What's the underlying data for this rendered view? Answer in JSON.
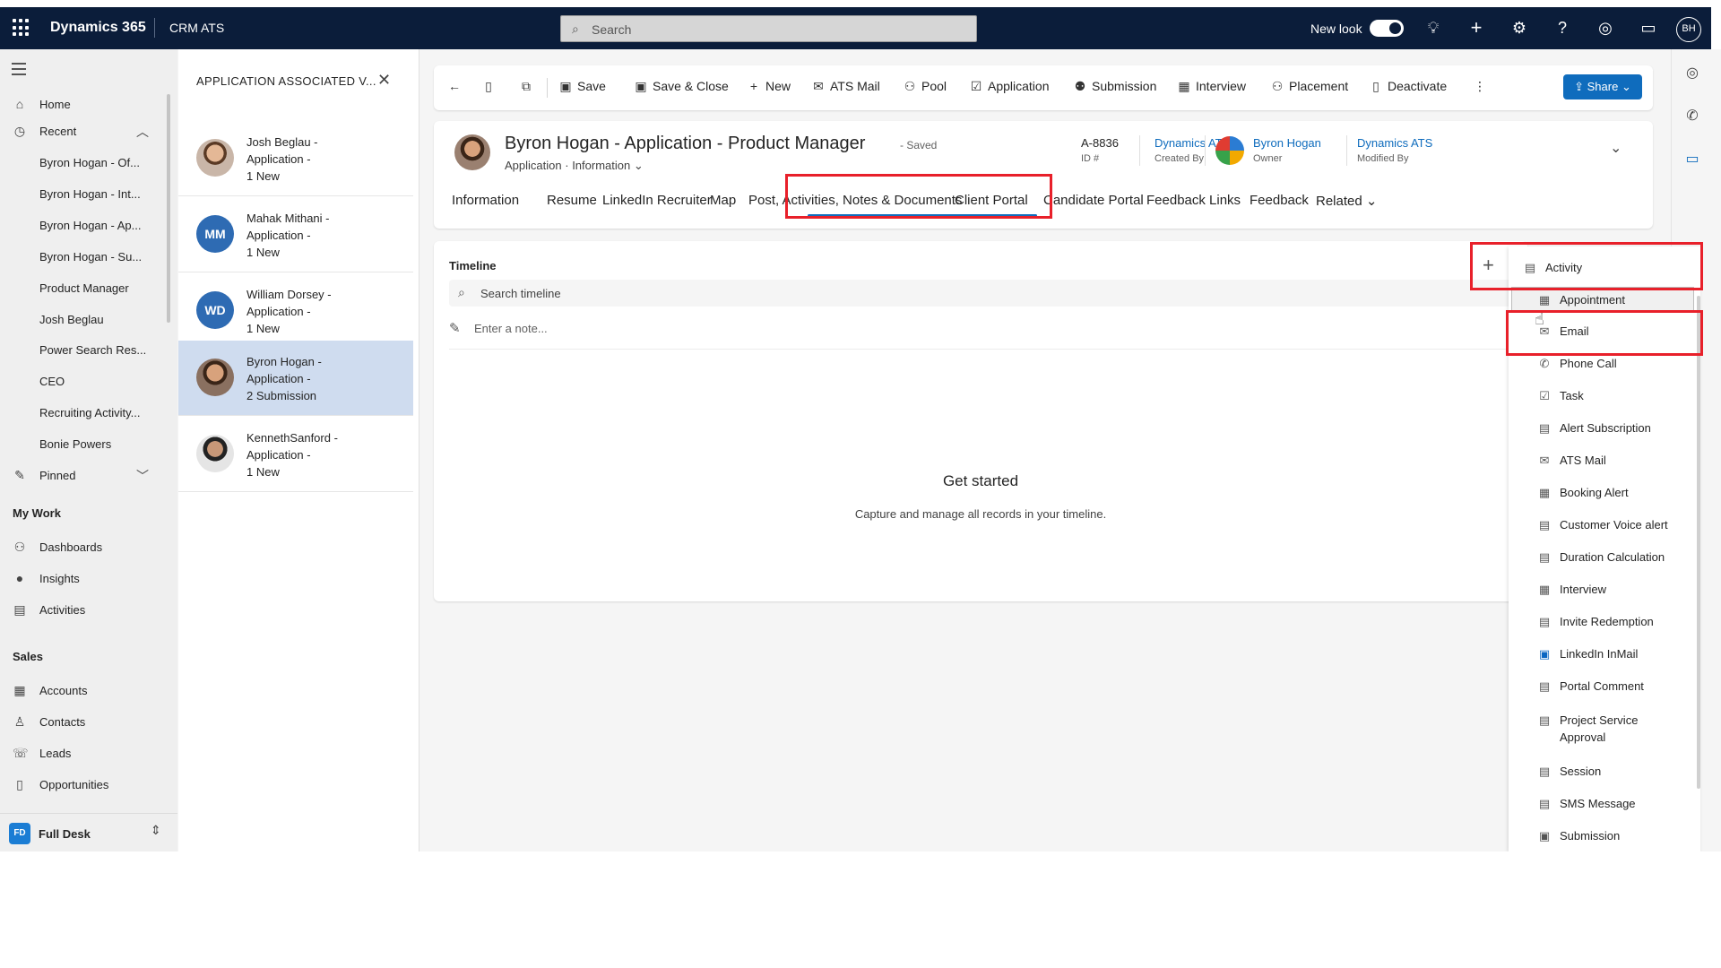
{
  "topbar": {
    "brand": "Dynamics 365",
    "app_name": "CRM ATS",
    "search_placeholder": "Search",
    "new_look_label": "New look",
    "avatar_initials": "BH"
  },
  "sidebar": {
    "home": "Home",
    "recent": "Recent",
    "recent_items": [
      "Byron Hogan - Of...",
      "Byron Hogan - Int...",
      "Byron Hogan - Ap...",
      "Byron Hogan - Su...",
      "Product Manager",
      "Josh Beglau",
      "Power Search Res...",
      "CEO",
      "Recruiting Activity...",
      "Bonie Powers"
    ],
    "pinned": "Pinned",
    "my_work_title": "My Work",
    "my_work": [
      "Dashboards",
      "Insights",
      "Activities"
    ],
    "sales_title": "Sales",
    "sales": [
      "Accounts",
      "Contacts",
      "Leads",
      "Opportunities"
    ],
    "footer_badge": "FD",
    "footer_label": "Full Desk"
  },
  "assoc": {
    "title": "APPLICATION ASSOCIATED V...",
    "rows": [
      {
        "line1": "Josh Beglau -",
        "line2": "Application -",
        "line3": "1 New",
        "initials": ""
      },
      {
        "line1": "Mahak Mithani -",
        "line2": "Application -",
        "line3": "1 New",
        "initials": "MM"
      },
      {
        "line1": "William Dorsey -",
        "line2": "Application -",
        "line3": "1 New",
        "initials": "WD"
      },
      {
        "line1": "Byron Hogan -",
        "line2": "Application -",
        "line3": "2 Submission",
        "initials": ""
      },
      {
        "line1": "KennethSanford -",
        "line2": "Application -",
        "line3": "1 New",
        "initials": ""
      }
    ]
  },
  "commands": {
    "save": "Save",
    "save_close": "Save & Close",
    "new": "New",
    "ats_mail": "ATS Mail",
    "pool": "Pool",
    "application": "Application",
    "submission": "Submission",
    "interview": "Interview",
    "placement": "Placement",
    "deactivate": "Deactivate",
    "share": "Share"
  },
  "record": {
    "title": "Byron Hogan - Application - Product Manager",
    "saved": "- Saved",
    "entity": "Application",
    "form": "Information",
    "id_value": "A-8836",
    "id_label": "ID #",
    "created_by_value": "Dynamics ATS",
    "created_by_label": "Created By",
    "owner_value": "Byron Hogan",
    "owner_label": "Owner",
    "modified_by_value": "Dynamics ATS",
    "modified_by_label": "Modified By"
  },
  "tabs": [
    "Information",
    "Resume",
    "LinkedIn Recruiter",
    "Map",
    "Post, Activities, Notes & Documents",
    "Client Portal",
    "Candidate Portal",
    "Feedback Links",
    "Feedback",
    "Related"
  ],
  "timeline": {
    "title": "Timeline",
    "search_placeholder": "Search timeline",
    "note_placeholder": "Enter a note...",
    "empty_title": "Get started",
    "empty_caption": "Capture and manage all records in your timeline."
  },
  "activity_menu": {
    "header": "Activity",
    "items": [
      "Appointment",
      "Email",
      "Phone Call",
      "Task",
      "Alert Subscription",
      "ATS Mail",
      "Booking Alert",
      "Customer Voice alert",
      "Duration Calculation",
      "Interview",
      "Invite Redemption",
      "LinkedIn InMail",
      "Portal Comment",
      "Project Service",
      "Approval",
      "Session",
      "SMS Message",
      "Submission"
    ]
  },
  "colors": {
    "nav_bg": "#0b1d3a",
    "accent": "#0f6cbd",
    "highlight": "#e8202a"
  }
}
